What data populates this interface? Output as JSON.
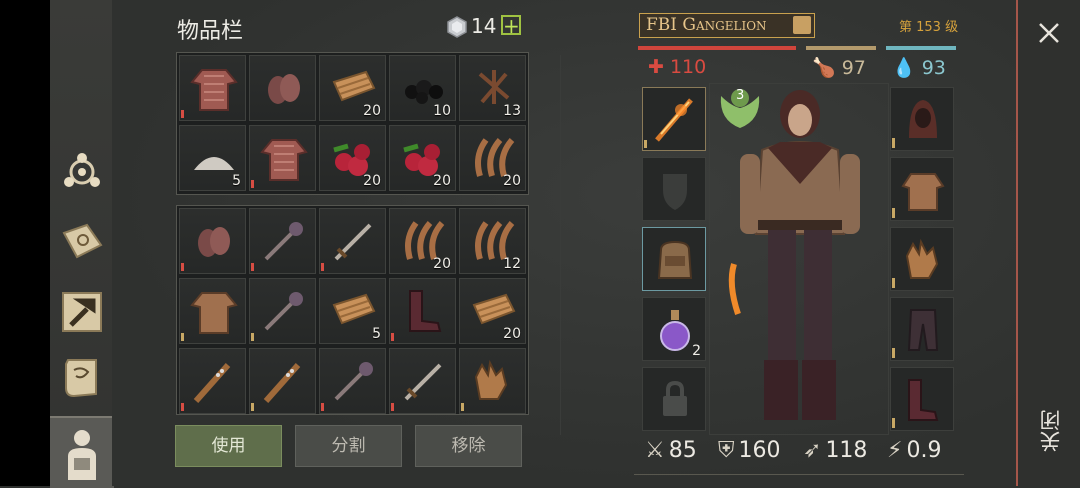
{
  "inventory": {
    "title": "物品栏",
    "currency_count": "14",
    "top_grid": [
      {
        "icon": "chainmail-armor-icon",
        "qty": "",
        "bar": "r"
      },
      {
        "icon": "chainmail-gloves-icon",
        "qty": "",
        "bar": ""
      },
      {
        "icon": "cloth-bundle-icon",
        "qty": "20",
        "bar": ""
      },
      {
        "icon": "coal-icon",
        "qty": "10",
        "bar": ""
      },
      {
        "icon": "nails-icon",
        "qty": "13",
        "bar": ""
      },
      {
        "icon": "powder-pile-icon",
        "qty": "5",
        "bar": ""
      },
      {
        "icon": "chainmail-armor-icon",
        "qty": "",
        "bar": "r"
      },
      {
        "icon": "berries-icon",
        "qty": "20",
        "bar": ""
      },
      {
        "icon": "berries-icon",
        "qty": "20",
        "bar": ""
      },
      {
        "icon": "fiber-icon",
        "qty": "20",
        "bar": ""
      }
    ],
    "bottom_grid": [
      {
        "icon": "chainmail-gloves-icon",
        "qty": "",
        "bar": "r"
      },
      {
        "icon": "spiked-mace-icon",
        "qty": "",
        "bar": "r"
      },
      {
        "icon": "sword-icon",
        "qty": "",
        "bar": "r"
      },
      {
        "icon": "fiber-icon",
        "qty": "20",
        "bar": ""
      },
      {
        "icon": "fiber-icon",
        "qty": "12",
        "bar": ""
      },
      {
        "icon": "leather-armor-icon",
        "qty": "",
        "bar": "y"
      },
      {
        "icon": "spiked-mace-icon",
        "qty": "",
        "bar": "y"
      },
      {
        "icon": "cloth-bundle-icon",
        "qty": "5",
        "bar": ""
      },
      {
        "icon": "boots-icon",
        "qty": "",
        "bar": "r"
      },
      {
        "icon": "cloth-bundle-icon",
        "qty": "20",
        "bar": ""
      },
      {
        "icon": "spiked-club-icon",
        "qty": "",
        "bar": "r"
      },
      {
        "icon": "spiked-club-icon",
        "qty": "",
        "bar": "y"
      },
      {
        "icon": "spiked-mace-icon",
        "qty": "",
        "bar": "r"
      },
      {
        "icon": "sword-icon",
        "qty": "",
        "bar": "r"
      },
      {
        "icon": "leather-gloves-icon",
        "qty": "",
        "bar": "y"
      }
    ],
    "actions": {
      "use": "使用",
      "split": "分割",
      "remove": "移除"
    }
  },
  "character": {
    "name": "FBI Gangelion",
    "level": "第 153 级",
    "health": "110",
    "food": "97",
    "water": "93",
    "buff_level": "3",
    "potion_qty": "2",
    "attack": "85",
    "defense": "160",
    "speed": "118",
    "attack_speed": "0.9",
    "colors": {
      "health": "#d0453c",
      "food": "#b39a6c",
      "water": "#6fb6bf"
    }
  },
  "close_label": "关闭"
}
